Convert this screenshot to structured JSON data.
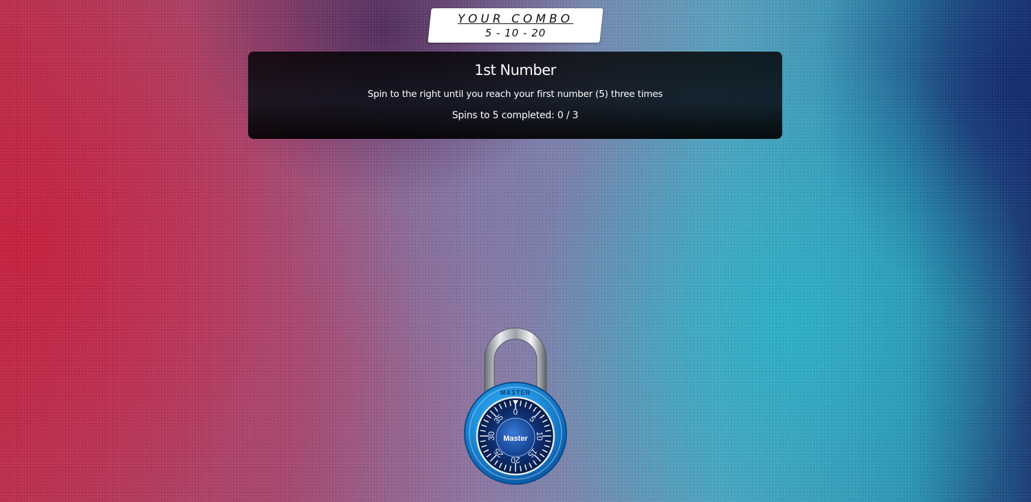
{
  "combo": {
    "title": "YOUR COMBO",
    "numbers": "5 - 10 - 20"
  },
  "step": {
    "title": "1st Number",
    "instruction": "Spin to the right until you reach your first number (5) three times",
    "progress": "Spins to 5 completed: 0 / 3"
  },
  "lock": {
    "brand": "Master",
    "rim_text": "MASTER",
    "dial_numbers": [
      "0",
      "5",
      "10",
      "15",
      "20",
      "25",
      "30",
      "35"
    ],
    "body_color": "#1e8fdc",
    "dial_color": "#0d2a66"
  },
  "colors": {
    "panel_bg": "#000000",
    "panel_text": "#ffffff",
    "tag_bg": "#ffffff"
  }
}
